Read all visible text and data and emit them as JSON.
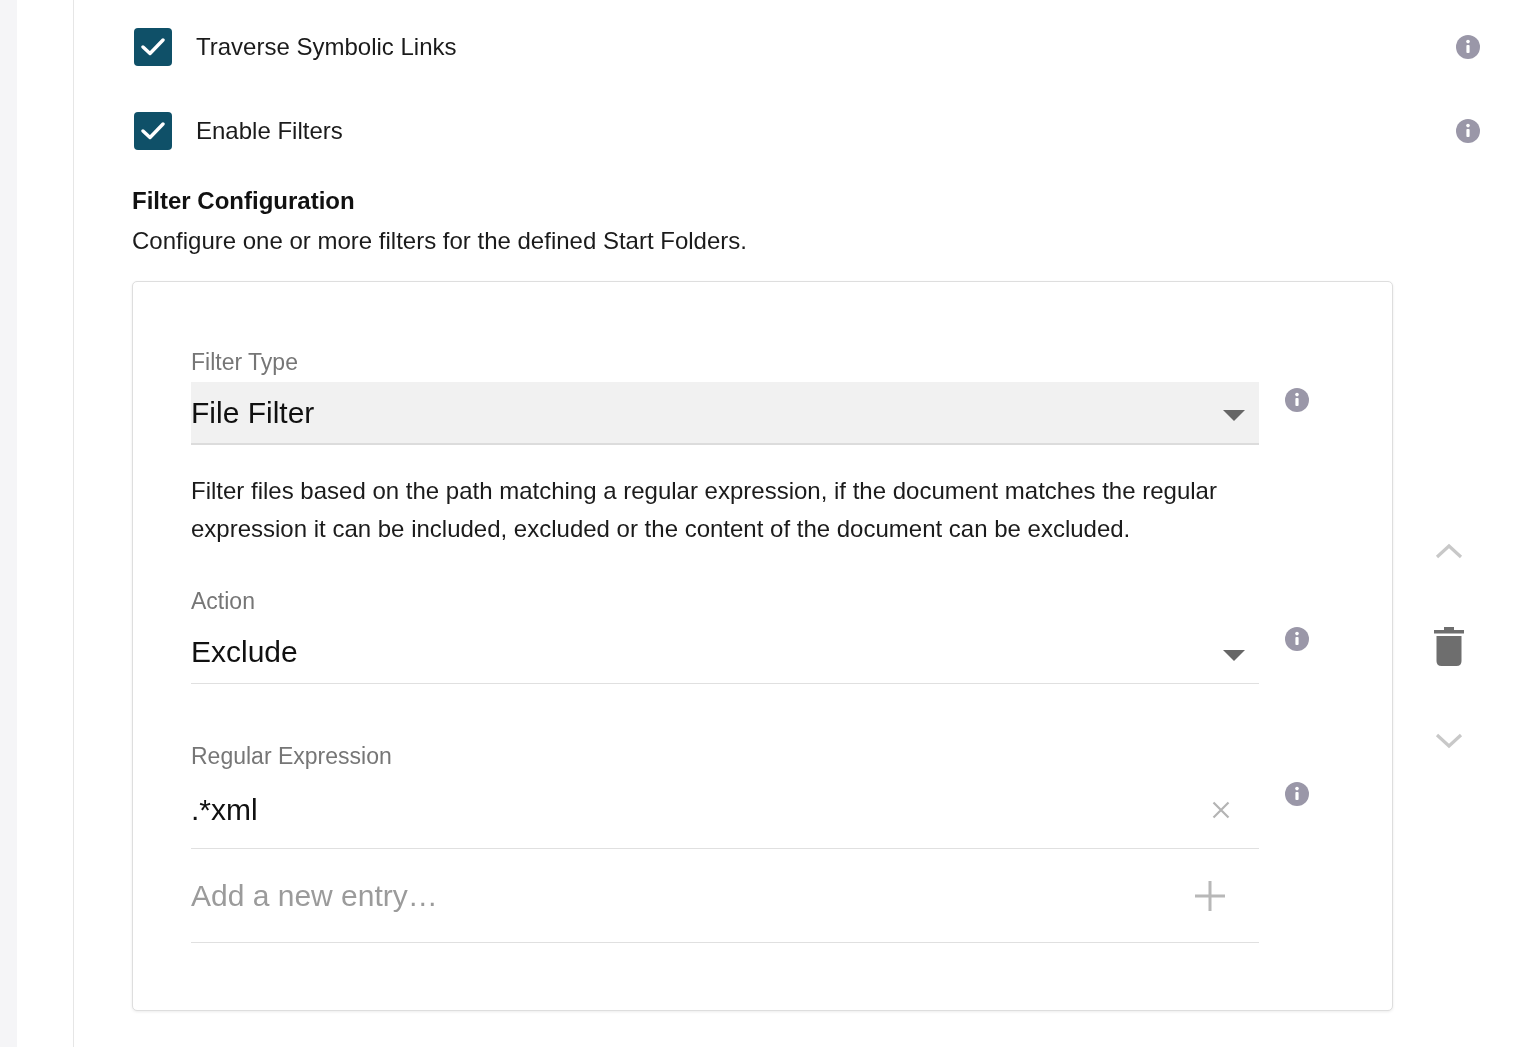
{
  "options": [
    {
      "label": "Traverse Symbolic Links",
      "checked": true
    },
    {
      "label": "Enable Filters",
      "checked": true
    }
  ],
  "filter_configuration": {
    "title": "Filter Configuration",
    "description": "Configure one or more filters for the defined Start Folders.",
    "filters": [
      {
        "filter_type": {
          "label": "Filter Type",
          "value": "File Filter",
          "highlighted": true
        },
        "description": "Filter files based on the path matching a regular expression, if the document matches the regular expression it can be included, excluded or the content of the document can be excluded.",
        "action": {
          "label": "Action",
          "value": "Exclude",
          "highlighted": false
        },
        "regular_expression": {
          "label": "Regular Expression",
          "entries": [
            ".*xml"
          ],
          "placeholder": "Add a new entry…"
        },
        "controls": [
          {
            "kind": "move-up",
            "disabled": true
          },
          {
            "kind": "delete",
            "disabled": false
          },
          {
            "kind": "move-down",
            "disabled": true
          }
        ]
      }
    ]
  }
}
